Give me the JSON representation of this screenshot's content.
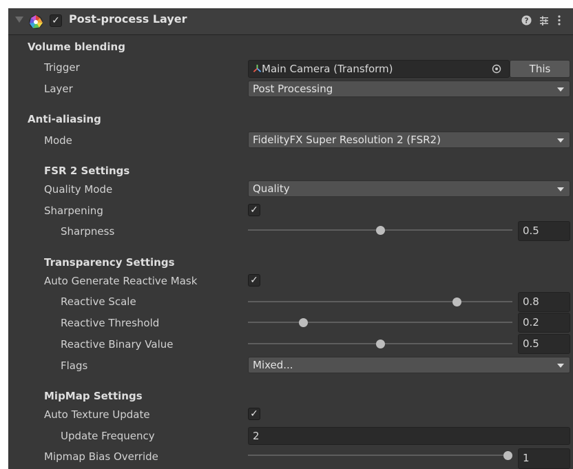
{
  "header": {
    "title": "Post-process Layer",
    "enabled_check": "✓",
    "help_icon": "help-icon",
    "presets_icon": "presets-icon",
    "menu_icon": "kebab-menu-icon"
  },
  "volume_blending": {
    "heading": "Volume blending",
    "trigger_label": "Trigger",
    "trigger_value": "Main Camera (Transform)",
    "this_button": "This",
    "layer_label": "Layer",
    "layer_value": "Post Processing"
  },
  "anti_aliasing": {
    "heading": "Anti-aliasing",
    "mode_label": "Mode",
    "mode_value": "FidelityFX Super Resolution 2 (FSR2)"
  },
  "fsr2": {
    "heading": "FSR 2 Settings",
    "quality_label": "Quality Mode",
    "quality_value": "Quality",
    "sharpening_label": "Sharpening",
    "sharpening_check": "✓",
    "sharpness_label": "Sharpness",
    "sharpness_value": "0.5",
    "sharpness_level": 0.5
  },
  "transparency": {
    "heading": "Transparency Settings",
    "auto_mask_label": "Auto Generate Reactive Mask",
    "auto_mask_check": "✓",
    "reactive_scale_label": "Reactive Scale",
    "reactive_scale_value": "0.8",
    "reactive_scale_level": 0.8,
    "reactive_threshold_label": "Reactive Threshold",
    "reactive_threshold_value": "0.2",
    "reactive_threshold_level": 0.2,
    "reactive_binary_label": "Reactive Binary Value",
    "reactive_binary_value": "0.5",
    "reactive_binary_level": 0.5,
    "flags_label": "Flags",
    "flags_value": "Mixed..."
  },
  "mipmap": {
    "heading": "MipMap Settings",
    "auto_update_label": "Auto Texture Update",
    "auto_update_check": "✓",
    "frequency_label": "Update Frequency",
    "frequency_value": "2",
    "bias_label": "Mipmap Bias Override",
    "bias_value": "1",
    "bias_level": 1.0
  },
  "colors": {
    "panel": "#383838",
    "header": "#3e3e3e",
    "field": "#2a2a2a",
    "dropdown": "#515151"
  }
}
